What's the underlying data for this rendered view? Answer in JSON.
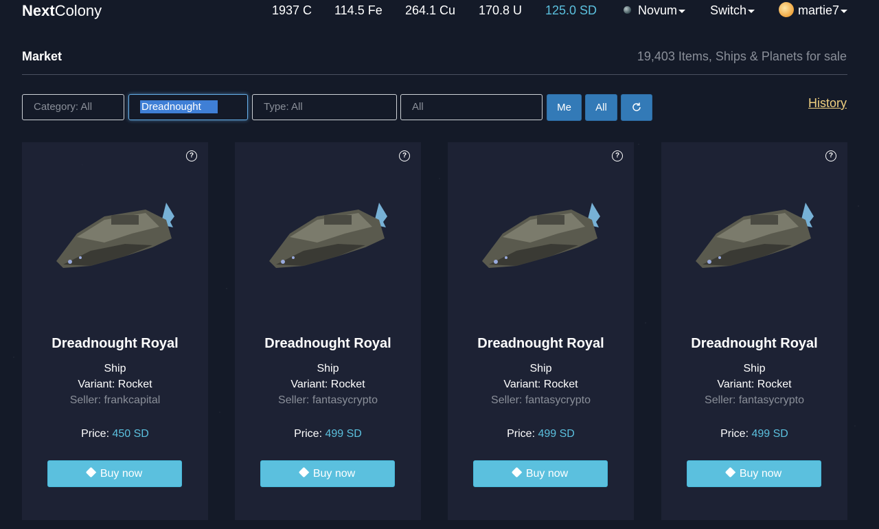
{
  "brand": {
    "bold": "Next",
    "rest": "Colony"
  },
  "resources": [
    {
      "label": "1937 C"
    },
    {
      "label": "114.5 Fe"
    },
    {
      "label": "264.1 Cu"
    },
    {
      "label": "170.8 U"
    },
    {
      "label": "125.0 SD"
    }
  ],
  "nav": {
    "planet": "Novum",
    "switch": "Switch",
    "user": "martie7"
  },
  "market": {
    "title": "Market",
    "count": "19,403 Items, Ships & Planets for sale"
  },
  "filters": {
    "category": "Category: All",
    "name": "Dreadnought",
    "type": "Type: All",
    "owner": "All",
    "btn_me": "Me",
    "btn_all": "All",
    "history": "History"
  },
  "cards": [
    {
      "title": "Dreadnought Royal",
      "kind": "Ship",
      "variant": "Variant: Rocket",
      "seller": "Seller: frankcapital",
      "price_label": "Price:",
      "price": "450 SD",
      "buy": "Buy now"
    },
    {
      "title": "Dreadnought Royal",
      "kind": "Ship",
      "variant": "Variant: Rocket",
      "seller": "Seller: fantasycrypto",
      "price_label": "Price:",
      "price": "499 SD",
      "buy": "Buy now"
    },
    {
      "title": "Dreadnought Royal",
      "kind": "Ship",
      "variant": "Variant: Rocket",
      "seller": "Seller: fantasycrypto",
      "price_label": "Price:",
      "price": "499 SD",
      "buy": "Buy now"
    },
    {
      "title": "Dreadnought Royal",
      "kind": "Ship",
      "variant": "Variant: Rocket",
      "seller": "Seller: fantasycrypto",
      "price_label": "Price:",
      "price": "499 SD",
      "buy": "Buy now"
    }
  ],
  "colors": {
    "accent": "#5bc0de",
    "primary": "#337ab7",
    "history": "#f0d080",
    "muted": "#8a8f99"
  }
}
